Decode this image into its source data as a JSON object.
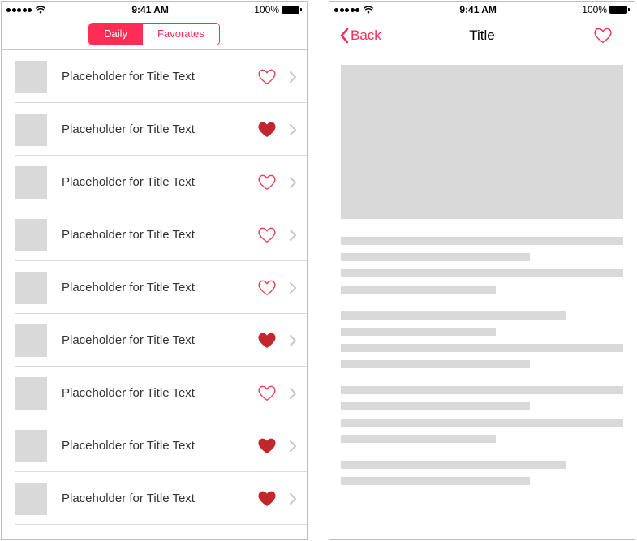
{
  "status": {
    "time": "9:41 AM",
    "battery": "100%"
  },
  "left": {
    "segmented": {
      "daily": "Daily",
      "favorates": "Favorates"
    },
    "items": [
      {
        "title": "Placeholder for Title Text",
        "favorited": false
      },
      {
        "title": "Placeholder for Title Text",
        "favorited": true
      },
      {
        "title": "Placeholder for Title Text",
        "favorited": false
      },
      {
        "title": "Placeholder for Title Text",
        "favorited": false
      },
      {
        "title": "Placeholder for Title Text",
        "favorited": false
      },
      {
        "title": "Placeholder for Title Text",
        "favorited": true
      },
      {
        "title": "Placeholder for Title Text",
        "favorited": false
      },
      {
        "title": "Placeholder for Title Text",
        "favorited": true
      },
      {
        "title": "Placeholder for Title Text",
        "favorited": true
      }
    ]
  },
  "right": {
    "back": "Back",
    "title": "Title",
    "paragraphs": [
      [
        100,
        67,
        100,
        55
      ],
      [
        80,
        55,
        100,
        67
      ],
      [
        100,
        67,
        100,
        55
      ],
      [
        80,
        67
      ]
    ]
  },
  "colors": {
    "accent": "#ff2d55",
    "heart_filled": "#c1272d",
    "heart_outline": "#e94256"
  }
}
